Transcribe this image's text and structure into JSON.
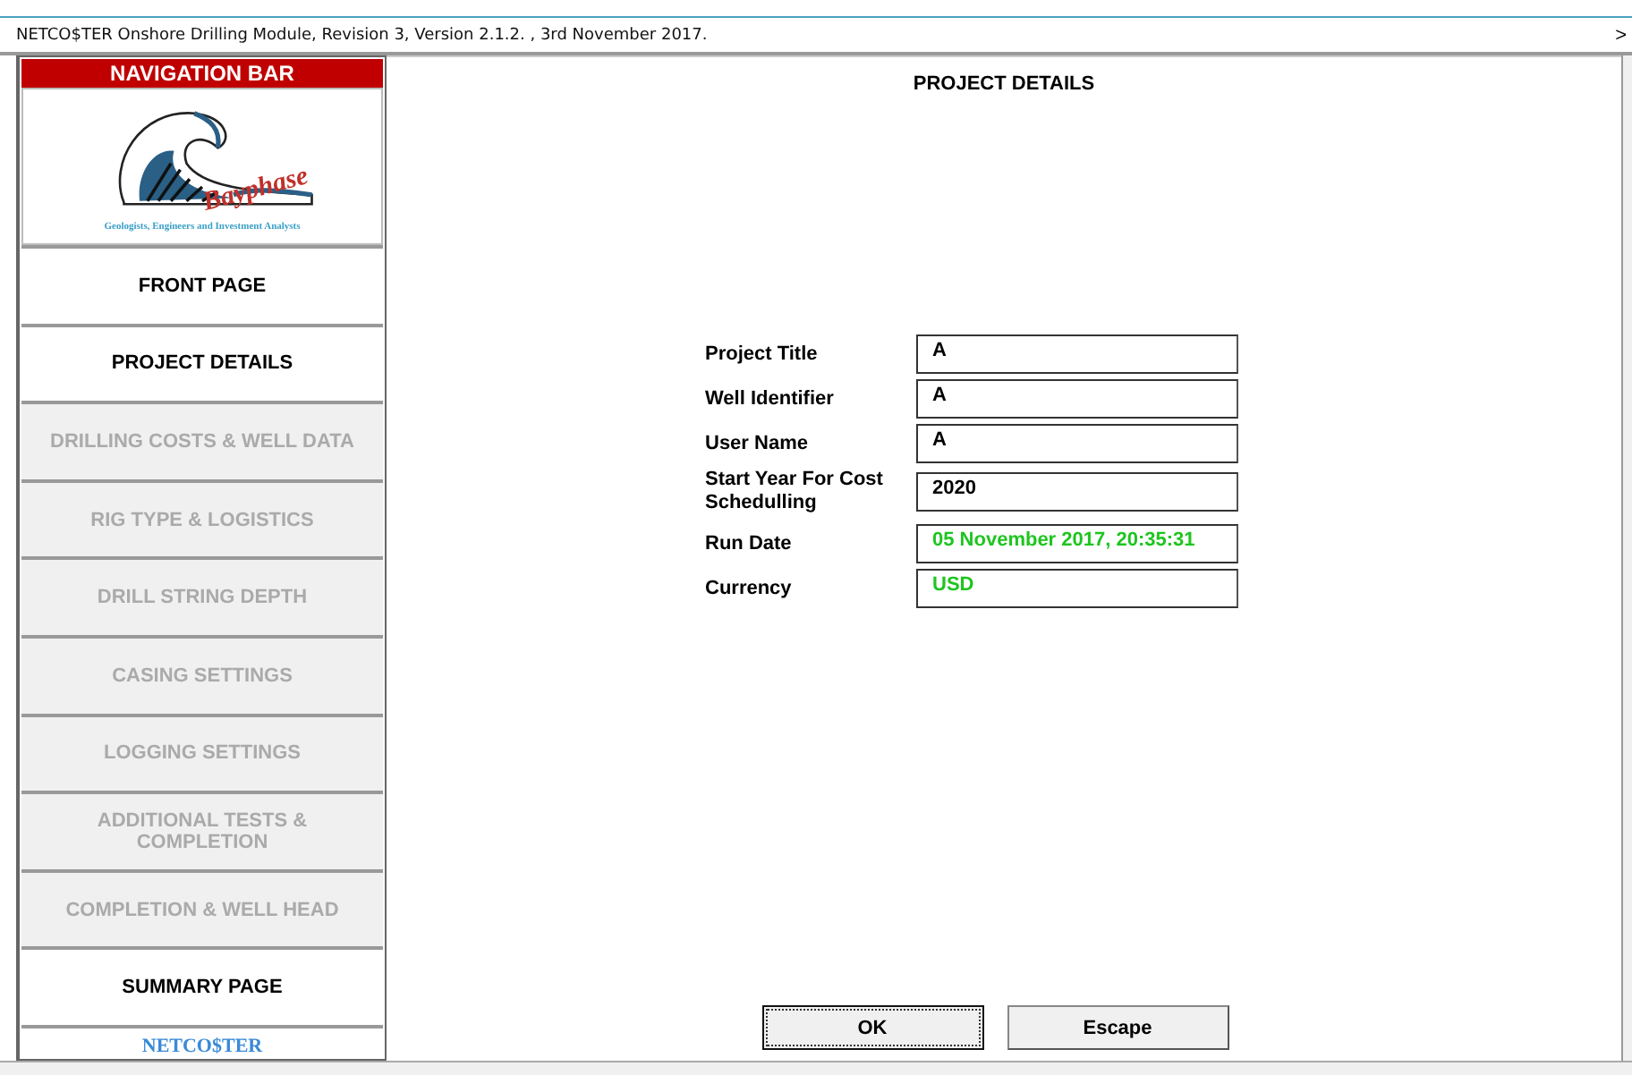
{
  "window": {
    "title": "NETCO$TER Onshore Drilling Module, Revision 3, Version 2.1.2. , 3rd November 2017.",
    "overflow_mark": ">"
  },
  "navigation": {
    "header": "NAVIGATION BAR",
    "logo": {
      "name": "Bayphase",
      "tagline": "Geologists, Engineers and Investment Analysts"
    },
    "items": [
      {
        "label": "FRONT PAGE",
        "disabled": false
      },
      {
        "label": "PROJECT DETAILS",
        "disabled": false
      },
      {
        "label": "DRILLING COSTS & WELL DATA",
        "disabled": true
      },
      {
        "label": "RIG TYPE & LOGISTICS",
        "disabled": true
      },
      {
        "label": "DRILL STRING DEPTH",
        "disabled": true
      },
      {
        "label": "CASING SETTINGS",
        "disabled": true
      },
      {
        "label": "LOGGING SETTINGS",
        "disabled": true
      },
      {
        "label": "ADDITIONAL TESTS & COMPLETION",
        "disabled": true
      },
      {
        "label": "COMPLETION & WELL HEAD",
        "disabled": true
      },
      {
        "label": "SUMMARY PAGE",
        "disabled": false
      }
    ],
    "footer": "NETCO$TER"
  },
  "main": {
    "title": "PROJECT DETAILS",
    "fields": [
      {
        "label": "Project Title",
        "value": "A",
        "computed": false
      },
      {
        "label": "Well Identifier",
        "value": "A",
        "computed": false
      },
      {
        "label": "User Name",
        "value": "A",
        "computed": false
      },
      {
        "label": "Start Year For Cost Schedulling",
        "value": "2020",
        "computed": false
      },
      {
        "label": "Run Date",
        "value": "05 November 2017, 20:35:31",
        "computed": true
      },
      {
        "label": "Currency",
        "value": "USD",
        "computed": true
      }
    ],
    "buttons": [
      {
        "label": "OK",
        "focused": true
      },
      {
        "label": "Escape",
        "focused": false
      }
    ]
  }
}
